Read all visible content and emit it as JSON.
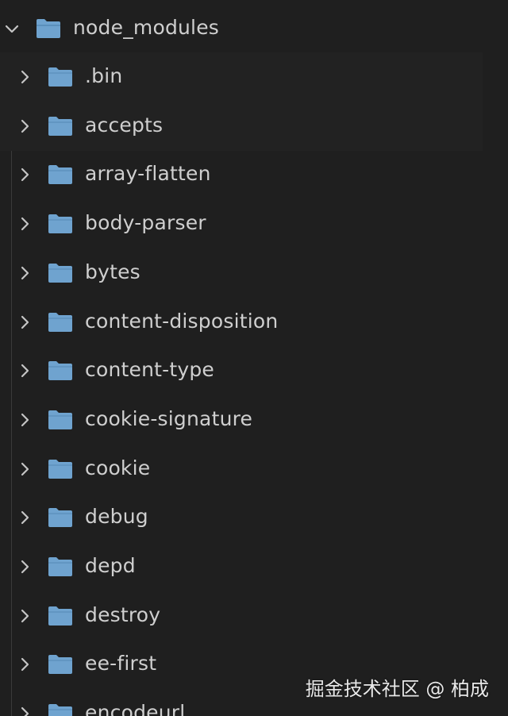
{
  "explorer": {
    "root": {
      "label": "node_modules",
      "icon": "folder-open-icon",
      "expanded": true
    },
    "items": [
      {
        "label": ".bin",
        "icon": "folder-icon",
        "expanded": false
      },
      {
        "label": "accepts",
        "icon": "folder-icon",
        "expanded": false
      },
      {
        "label": "array-flatten",
        "icon": "folder-icon",
        "expanded": false
      },
      {
        "label": "body-parser",
        "icon": "folder-icon",
        "expanded": false
      },
      {
        "label": "bytes",
        "icon": "folder-icon",
        "expanded": false
      },
      {
        "label": "content-disposition",
        "icon": "folder-icon",
        "expanded": false
      },
      {
        "label": "content-type",
        "icon": "folder-icon",
        "expanded": false
      },
      {
        "label": "cookie-signature",
        "icon": "folder-icon",
        "expanded": false
      },
      {
        "label": "cookie",
        "icon": "folder-icon",
        "expanded": false
      },
      {
        "label": "debug",
        "icon": "folder-icon",
        "expanded": false
      },
      {
        "label": "depd",
        "icon": "folder-icon",
        "expanded": false
      },
      {
        "label": "destroy",
        "icon": "folder-icon",
        "expanded": false
      },
      {
        "label": "ee-first",
        "icon": "folder-icon",
        "expanded": false
      },
      {
        "label": "encodeurl",
        "icon": "folder-icon",
        "expanded": false
      }
    ]
  },
  "watermark": {
    "text": "掘金技术社区 @ 柏成"
  },
  "colors": {
    "background": "#1f1f1f",
    "folder": "#6fa3cf",
    "text": "#cccccc",
    "chevron": "#c5c5c5"
  }
}
